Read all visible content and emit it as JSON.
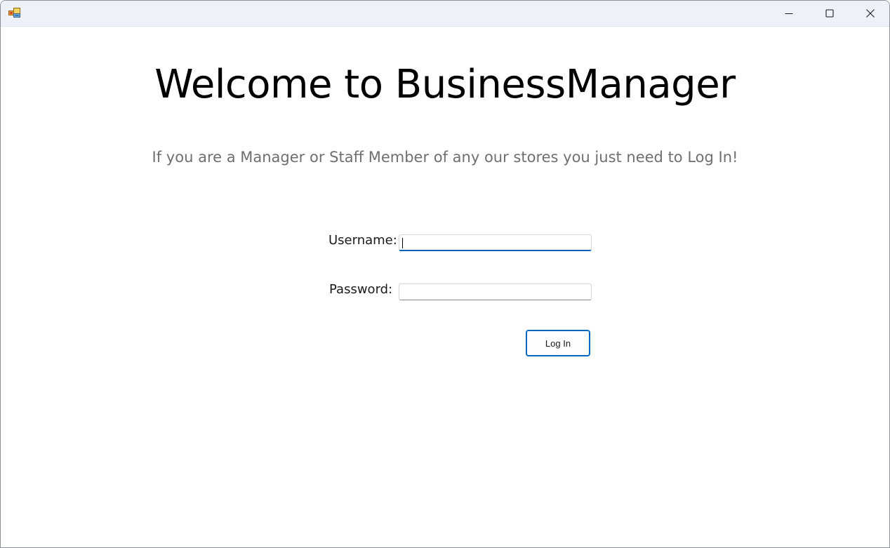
{
  "window": {
    "icon": "app-icon",
    "controls": {
      "minimize_icon": "minimize-icon",
      "maximize_icon": "maximize-icon",
      "close_icon": "close-icon"
    }
  },
  "main": {
    "title": "Welcome to BusinessManager",
    "subtitle": "If you are a Manager or Staff Member of any our stores you just need to Log In!"
  },
  "form": {
    "username_label": "Username:",
    "username_value": "",
    "password_label": "Password:",
    "password_value": "",
    "login_label": "Log In"
  },
  "colors": {
    "accent": "#005fb8",
    "titlebar": "#eef1f9",
    "subtitle_text": "#6f6f6f"
  }
}
